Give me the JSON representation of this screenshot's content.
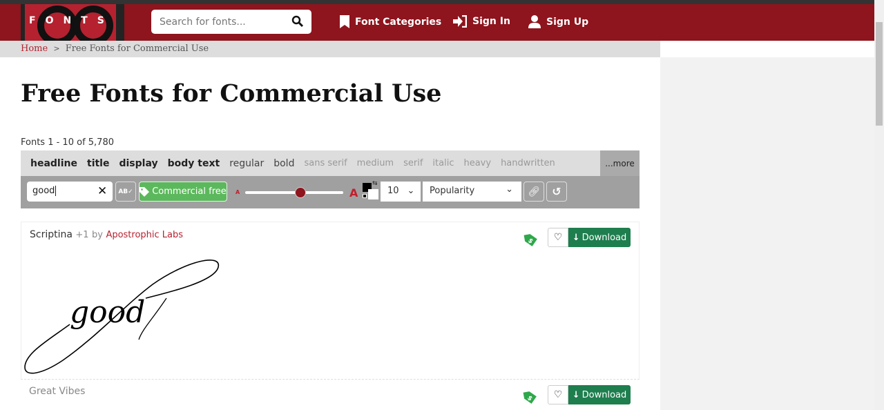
{
  "header": {
    "logo": "1001 FONTS",
    "search_placeholder": "Search for fonts...",
    "nav": [
      {
        "label": "Font Categories",
        "icon": "bookmark-icon"
      },
      {
        "label": "Sign In",
        "icon": "sign-in-icon"
      },
      {
        "label": "Sign Up",
        "icon": "user-icon"
      }
    ]
  },
  "breadcrumb": {
    "home": "Home",
    "sep": ">",
    "current": "Free Fonts for Commercial Use"
  },
  "page": {
    "title": "Free Fonts for Commercial Use",
    "count": "Fonts 1 - 10 of 5,780"
  },
  "tags": {
    "bold": [
      "headline",
      "title",
      "display",
      "body text",
      "regular",
      "bold"
    ],
    "light": [
      "sans serif",
      "medium",
      "serif",
      "italic",
      "heavy",
      "handwritten"
    ],
    "more": "...more"
  },
  "tools": {
    "preview_text": "good",
    "commercial_free": "Commercial free",
    "size_small": "A",
    "size_large": "A",
    "font_size_fraction": 0.56,
    "per_page": "10",
    "sort": "Popularity",
    "colors": {
      "fg": "#000000",
      "bg": "#ffffff",
      "accent": "#8e141d",
      "green": "#5cb85c"
    }
  },
  "fonts": [
    {
      "name": "Scriptina",
      "plus": "+1",
      "by": "by",
      "author": "Apostrophic Labs",
      "download": "Download",
      "preview": "good"
    },
    {
      "name": "Great Vibes",
      "download": "Download"
    }
  ]
}
